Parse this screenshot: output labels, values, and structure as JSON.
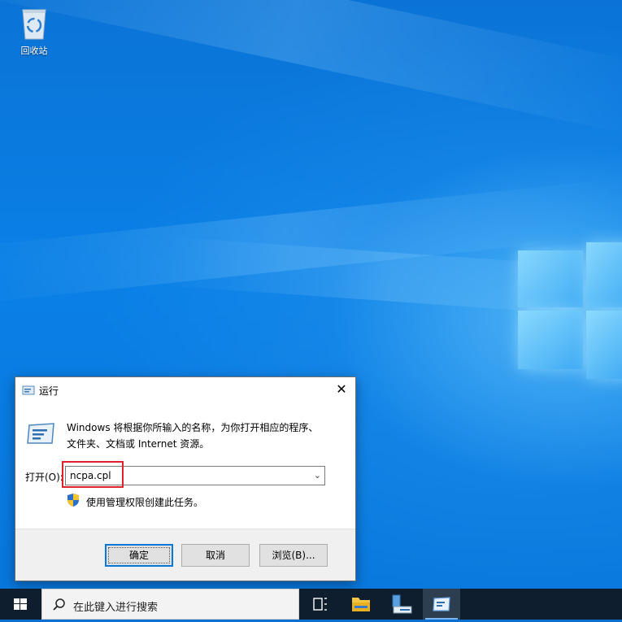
{
  "desktop": {
    "recycle_bin_label": "回收站"
  },
  "run_dialog": {
    "title": "运行",
    "description_line1": "Windows 将根据你所输入的名称，为你打开相应的程序、",
    "description_line2": "文件夹、文档或 Internet 资源。",
    "open_label": "打开(O):",
    "command_value": "ncpa.cpl",
    "admin_note": "使用管理权限创建此任务。",
    "buttons": {
      "ok": "确定",
      "cancel": "取消",
      "browse": "浏览(B)..."
    },
    "close_glyph": "✕"
  },
  "taskbar": {
    "search_placeholder": "在此键入进行搜索",
    "accent_color": "#7ab6f0"
  },
  "colors": {
    "highlight_box": "#e0222a",
    "primary_button_border": "#0078d7"
  }
}
